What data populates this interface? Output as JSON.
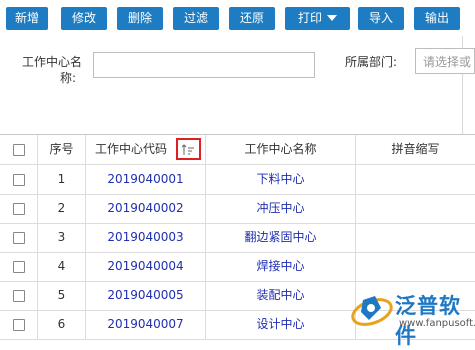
{
  "toolbar": {
    "new": "新增",
    "edit": "修改",
    "delete": "删除",
    "filter": "过滤",
    "restore": "还原",
    "print": "打印",
    "import": "导入",
    "export": "输出"
  },
  "form": {
    "work_center_name_label_1": "工作中心名",
    "work_center_name_label_2": "称:",
    "work_center_name_value": "",
    "department_label": "所属部门:",
    "department_placeholder": "请选择或"
  },
  "table": {
    "headers": {
      "index": "序号",
      "code": "工作中心代码",
      "name": "工作中心名称",
      "pinyin": "拼音缩写"
    },
    "rows": [
      {
        "index": "1",
        "code": "2019040001",
        "name": "下料中心",
        "pinyin": ""
      },
      {
        "index": "2",
        "code": "2019040002",
        "name": "冲压中心",
        "pinyin": ""
      },
      {
        "index": "3",
        "code": "2019040003",
        "name": "翻边紧固中心",
        "pinyin": ""
      },
      {
        "index": "4",
        "code": "2019040004",
        "name": "焊接中心",
        "pinyin": ""
      },
      {
        "index": "5",
        "code": "2019040005",
        "name": "装配中心",
        "pinyin": ""
      },
      {
        "index": "6",
        "code": "2019040007",
        "name": "设计中心",
        "pinyin": ""
      }
    ]
  },
  "watermark": {
    "brand": "泛普软件",
    "url": "www.fanpusoft.com"
  },
  "colors": {
    "button": "#1e7cc2",
    "link": "#1f2fb0",
    "highlight": "#e02020"
  }
}
